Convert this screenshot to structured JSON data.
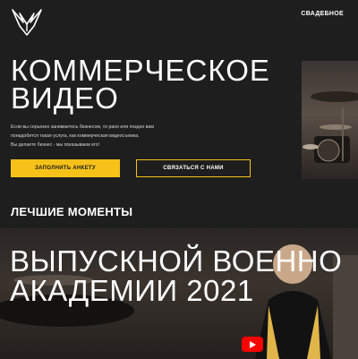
{
  "nav": {
    "wedding_link": "СВАДЕБНОЕ"
  },
  "hero": {
    "title_line1": "КОММЕРЧЕСКОЕ",
    "title_line2": "ВИДЕО",
    "description": [
      "Если вы серьезно занимаетесь бизнесом, то рано или поздно вам",
      "понадобится такая услуга, как коммерческая видеосъемка.",
      "Вы делаете бизнес - мы показываем его!"
    ],
    "fill_form_button": "ЗАПОЛНИТЬ АНКЕТУ",
    "contact_button": "СВЯЗАТЬСЯ С НАМИ"
  },
  "highlights": {
    "section_title": "ЛЕЧШИЕ МОМЕНТЫ",
    "video_title_line1": "ВЫПУСКНОЙ ВОЕННО",
    "video_title_line2": "АКАДЕМИИ 2021"
  },
  "colors": {
    "accent": "#f6c21a",
    "background": "#1e1e1e",
    "youtube": "#ff0000"
  },
  "icons": {
    "logo": "eagle-logo-icon",
    "play": "youtube-play-icon"
  }
}
